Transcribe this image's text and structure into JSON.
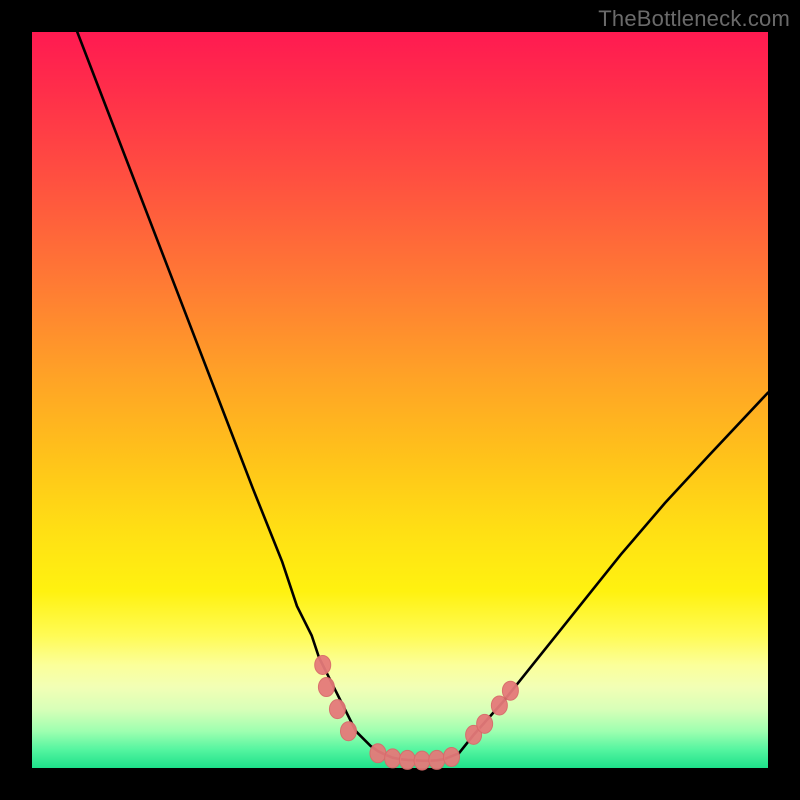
{
  "watermark": "TheBottleneck.com",
  "colors": {
    "frame": "#000000",
    "curve": "#000000",
    "marker": "#e57a7a",
    "gradient_top": "#ff1a51",
    "gradient_bottom": "#1de08a"
  },
  "chart_data": {
    "type": "line",
    "title": "",
    "xlabel": "",
    "ylabel": "",
    "xlim": [
      0,
      100
    ],
    "ylim": [
      0,
      100
    ],
    "x": [
      5,
      10,
      15,
      20,
      25,
      30,
      32,
      34,
      36,
      37,
      38,
      39,
      40,
      41,
      42,
      43,
      44,
      45,
      46,
      47,
      48,
      49,
      50,
      51,
      52,
      53,
      54,
      55,
      56,
      58,
      60,
      64,
      68,
      72,
      76,
      80,
      86,
      92,
      100
    ],
    "y": [
      103,
      90,
      77,
      64,
      51,
      38,
      33,
      28,
      22,
      20,
      18,
      15,
      13,
      11,
      9,
      7,
      5,
      4,
      3,
      2.3,
      1.8,
      1.4,
      1.2,
      1.1,
      1.05,
      1.0,
      1.0,
      1.05,
      1.2,
      2.0,
      4.5,
      9,
      14,
      19,
      24,
      29,
      36,
      42.5,
      51
    ],
    "series": [
      {
        "name": "bottleneck-curve"
      }
    ],
    "markers": [
      {
        "x": 39.5,
        "y": 14,
        "label": "left-upper-marker-1"
      },
      {
        "x": 40.0,
        "y": 11,
        "label": "left-upper-marker-2"
      },
      {
        "x": 41.5,
        "y": 8,
        "label": "left-mid-marker"
      },
      {
        "x": 43.0,
        "y": 5,
        "label": "left-lower-marker"
      },
      {
        "x": 47.0,
        "y": 2,
        "label": "trough-left-marker"
      },
      {
        "x": 49.0,
        "y": 1.3,
        "label": "trough-marker-1"
      },
      {
        "x": 51.0,
        "y": 1.1,
        "label": "trough-marker-2"
      },
      {
        "x": 53.0,
        "y": 1.0,
        "label": "trough-marker-3"
      },
      {
        "x": 55.0,
        "y": 1.1,
        "label": "trough-marker-4"
      },
      {
        "x": 57.0,
        "y": 1.5,
        "label": "trough-right-marker"
      },
      {
        "x": 60.0,
        "y": 4.5,
        "label": "right-lower-marker"
      },
      {
        "x": 61.5,
        "y": 6.0,
        "label": "right-mid-marker-1"
      },
      {
        "x": 63.5,
        "y": 8.5,
        "label": "right-upper-marker-1"
      },
      {
        "x": 65.0,
        "y": 10.5,
        "label": "right-upper-marker-2"
      }
    ]
  }
}
